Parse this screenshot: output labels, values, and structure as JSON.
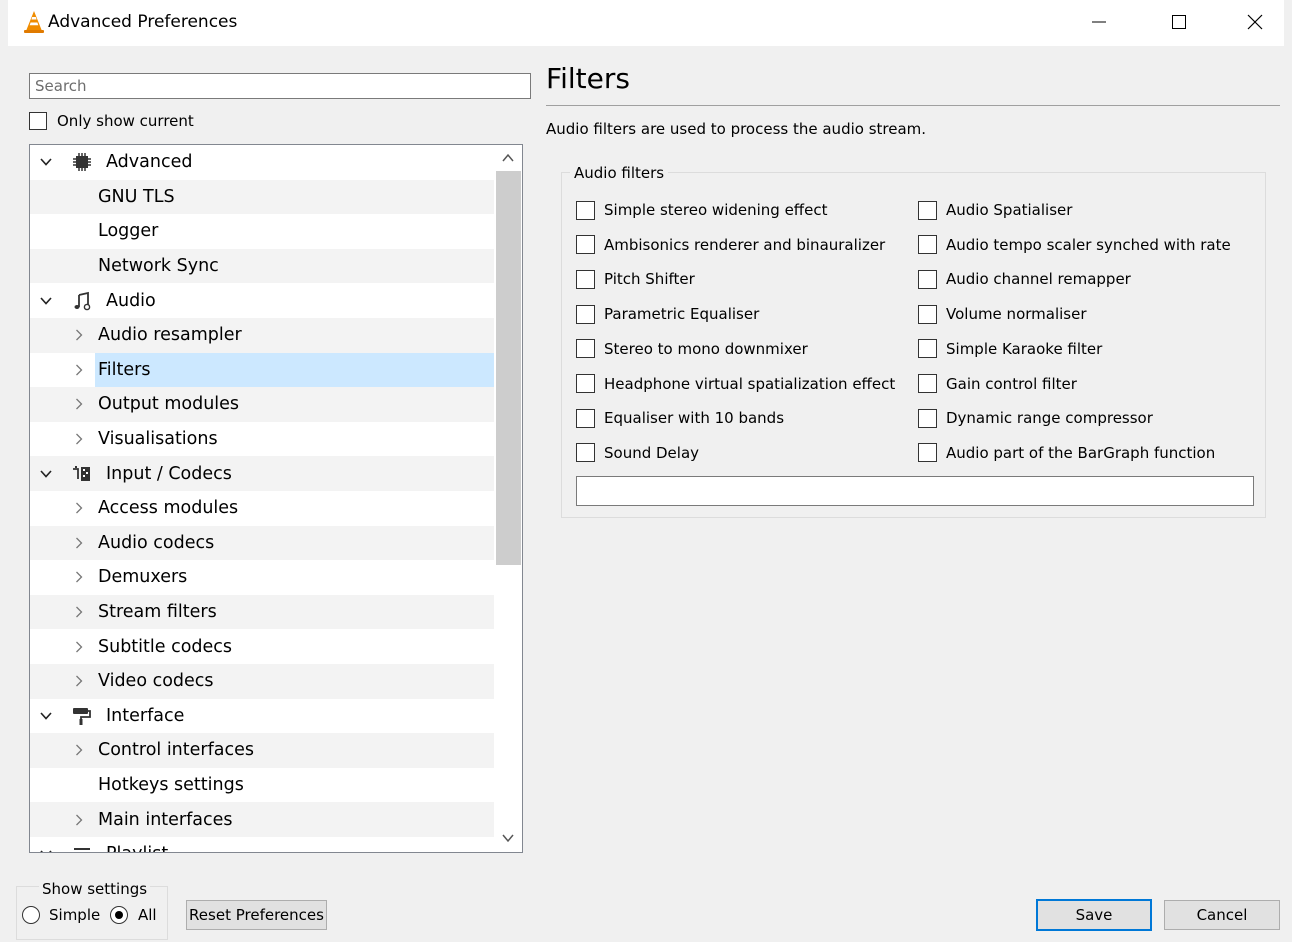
{
  "window": {
    "title": "Advanced Preferences",
    "controls": [
      "minimize",
      "maximize",
      "close"
    ]
  },
  "search": {
    "placeholder": "Search",
    "value": ""
  },
  "only_show_current": {
    "label": "Only show current",
    "checked": false
  },
  "tree": {
    "items": [
      {
        "label": "Advanced",
        "level": 0,
        "expander": "expanded",
        "icon": "chip-icon"
      },
      {
        "label": "GNU TLS",
        "level": 1,
        "expander": "none"
      },
      {
        "label": "Logger",
        "level": 1,
        "expander": "none"
      },
      {
        "label": "Network Sync",
        "level": 1,
        "expander": "none"
      },
      {
        "label": "Audio",
        "level": 0,
        "expander": "expanded",
        "icon": "music-note-icon"
      },
      {
        "label": "Audio resampler",
        "level": 1,
        "expander": "collapsed"
      },
      {
        "label": "Filters",
        "level": 1,
        "expander": "collapsed",
        "selected": true
      },
      {
        "label": "Output modules",
        "level": 1,
        "expander": "collapsed"
      },
      {
        "label": "Visualisations",
        "level": 1,
        "expander": "collapsed"
      },
      {
        "label": "Input / Codecs",
        "level": 0,
        "expander": "expanded",
        "icon": "codec-icon"
      },
      {
        "label": "Access modules",
        "level": 1,
        "expander": "collapsed"
      },
      {
        "label": "Audio codecs",
        "level": 1,
        "expander": "collapsed"
      },
      {
        "label": "Demuxers",
        "level": 1,
        "expander": "collapsed"
      },
      {
        "label": "Stream filters",
        "level": 1,
        "expander": "collapsed"
      },
      {
        "label": "Subtitle codecs",
        "level": 1,
        "expander": "collapsed"
      },
      {
        "label": "Video codecs",
        "level": 1,
        "expander": "collapsed"
      },
      {
        "label": "Interface",
        "level": 0,
        "expander": "expanded",
        "icon": "paint-roller-icon"
      },
      {
        "label": "Control interfaces",
        "level": 1,
        "expander": "collapsed"
      },
      {
        "label": "Hotkeys settings",
        "level": 1,
        "expander": "none"
      },
      {
        "label": "Main interfaces",
        "level": 1,
        "expander": "collapsed"
      },
      {
        "label": "Playlist",
        "level": 0,
        "expander": "expanded",
        "icon": "playlist-icon"
      }
    ]
  },
  "show_settings": {
    "legend": "Show settings",
    "simple_label": "Simple",
    "all_label": "All",
    "selected": "All"
  },
  "reset_button": "Reset Preferences",
  "panel": {
    "title": "Filters",
    "description": "Audio filters are used to process the audio stream.",
    "group_title": "Audio filters",
    "left_options": [
      "Simple stereo widening effect",
      "Ambisonics renderer and binauralizer",
      "Pitch Shifter",
      "Parametric Equaliser",
      "Stereo to mono downmixer",
      "Headphone virtual spatialization effect",
      "Equaliser with 10 bands",
      "Sound Delay"
    ],
    "right_options": [
      "Audio Spatialiser",
      "Audio tempo scaler synched with rate",
      "Audio channel remapper",
      "Volume normaliser",
      "Simple Karaoke filter",
      "Gain control filter",
      "Dynamic range compressor",
      "Audio part of the BarGraph function"
    ],
    "filter_text_value": ""
  },
  "save_button": "Save",
  "cancel_button": "Cancel",
  "colors": {
    "selection": "#cce8ff",
    "accent": "#0078d7",
    "vlc_orange": "#f08c00"
  }
}
